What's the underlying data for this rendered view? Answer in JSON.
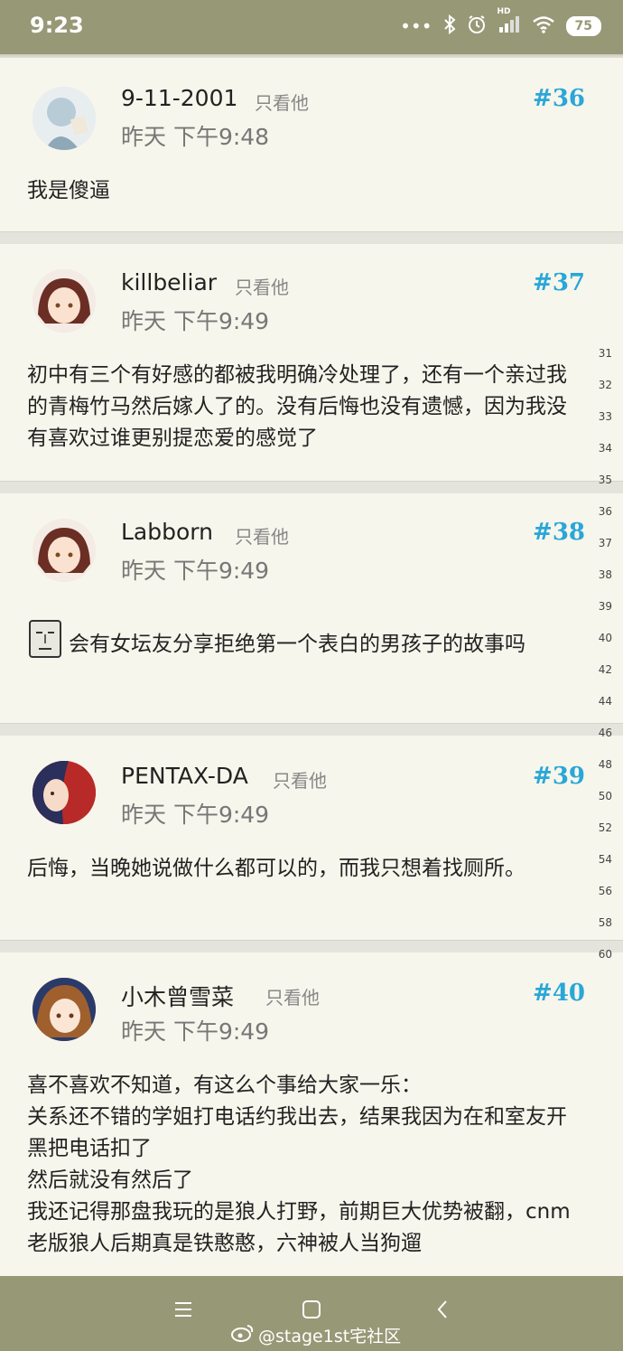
{
  "status_bar": {
    "time": "9:23",
    "battery": "75",
    "hd": "HD"
  },
  "actions": {
    "only_him": "只看他"
  },
  "posts": [
    {
      "username": "9-11-2001",
      "floor": "#36",
      "time": "昨天 下午9:48",
      "lines": [
        "我是傻逼"
      ]
    },
    {
      "username": "killbeliar",
      "floor": "#37",
      "time": "昨天 下午9:49",
      "lines": [
        "初中有三个有好感的都被我明确冷处理了，还有一个亲过我的青梅竹马然后嫁人了的。没有后悔也没有遗憾，因为我没有喜欢过谁更别提恋爱的感觉了"
      ]
    },
    {
      "username": "Labborn",
      "floor": "#38",
      "time": "昨天 下午9:49",
      "lines": [
        "会有女坛友分享拒绝第一个表白的男孩子的故事吗"
      ]
    },
    {
      "username": "PENTAX-DA",
      "floor": "#39",
      "time": "昨天 下午9:49",
      "lines": [
        "后悔，当晚她说做什么都可以的，而我只想着找厕所。"
      ]
    },
    {
      "username": "小木曾雪菜",
      "floor": "#40",
      "time": "昨天 下午9:49",
      "lines": [
        "喜不喜欢不知道，有这么个事给大家一乐：",
        "关系还不错的学姐打电话约我出去，结果我因为在和室友开黑把电话扣了",
        "然后就没有然后了",
        "我还记得那盘我玩的是狼人打野，前期巨大优势被翻，cnm老版狼人后期真是铁憨憨，六神被人当狗遛"
      ]
    }
  ],
  "scroll_index": [
    "31",
    "32",
    "33",
    "34",
    "35",
    "36",
    "37",
    "38",
    "39",
    "40",
    "42",
    "44",
    "46",
    "48",
    "50",
    "52",
    "54",
    "56",
    "58",
    "60"
  ],
  "watermark": "@stage1st宅社区",
  "colors": {
    "bar": "#979876",
    "floor": "#2aa6d8",
    "card": "#f6f6ec"
  }
}
